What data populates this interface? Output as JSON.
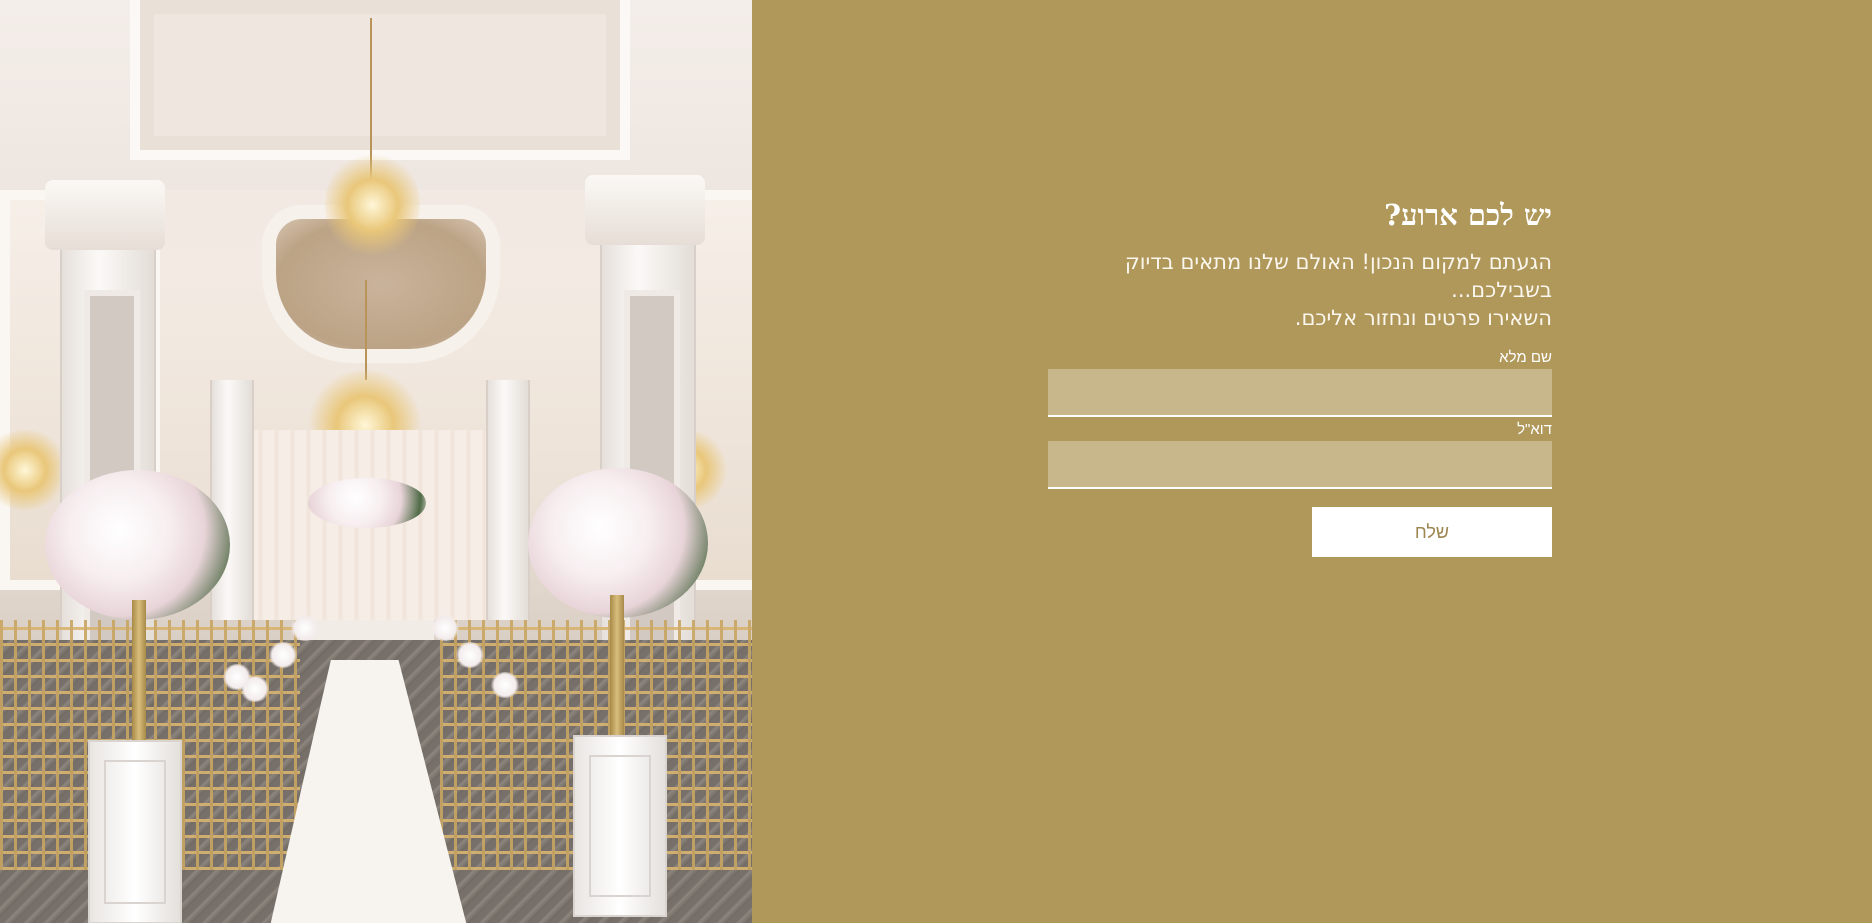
{
  "hero_image": {
    "subject": "wedding-hall-photo",
    "alt": ""
  },
  "form": {
    "title": "יש לכם ארוע?",
    "subtitle_line1": "הגעתם למקום הנכון! האולם שלנו מתאים בדיוק בשבילכם...",
    "subtitle_line2": "השאירו פרטים ונחזור אליכם.",
    "name_label": "שם מלא",
    "name_value": "",
    "email_label": "דוא\"ל",
    "email_value": "",
    "submit_label": "שלח"
  },
  "colors": {
    "panel_background": "#b0985a",
    "input_background": "#c7b78a",
    "button_background": "#ffffff",
    "button_text": "#9c8550",
    "text": "#ffffff"
  }
}
